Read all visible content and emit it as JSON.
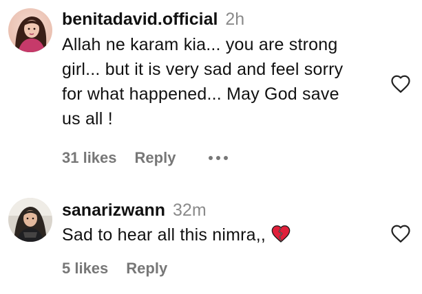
{
  "comments": [
    {
      "username": "benitadavid.official",
      "time": "2h",
      "lines": [
        "Allah ne karam kia... you are strong",
        "girl... but it is very sad and feel sorry",
        "for what happened... May God save",
        "us all !"
      ],
      "likes": "31 likes",
      "reply": "Reply",
      "has_more": true,
      "like_icon": "heart-outline-icon",
      "avatar": "profile-photo"
    },
    {
      "username": "sanarizwann",
      "time": "32m",
      "lines": [
        "Sad to hear all this nimra,,"
      ],
      "emoji": "broken-heart",
      "likes": "5 likes",
      "reply": "Reply",
      "has_more": false,
      "like_icon": "heart-outline-icon",
      "avatar": "profile-photo"
    }
  ],
  "colors": {
    "text": "#111111",
    "muted": "#8a8a8a",
    "action": "#777777",
    "broken_heart": "#e0203a"
  }
}
